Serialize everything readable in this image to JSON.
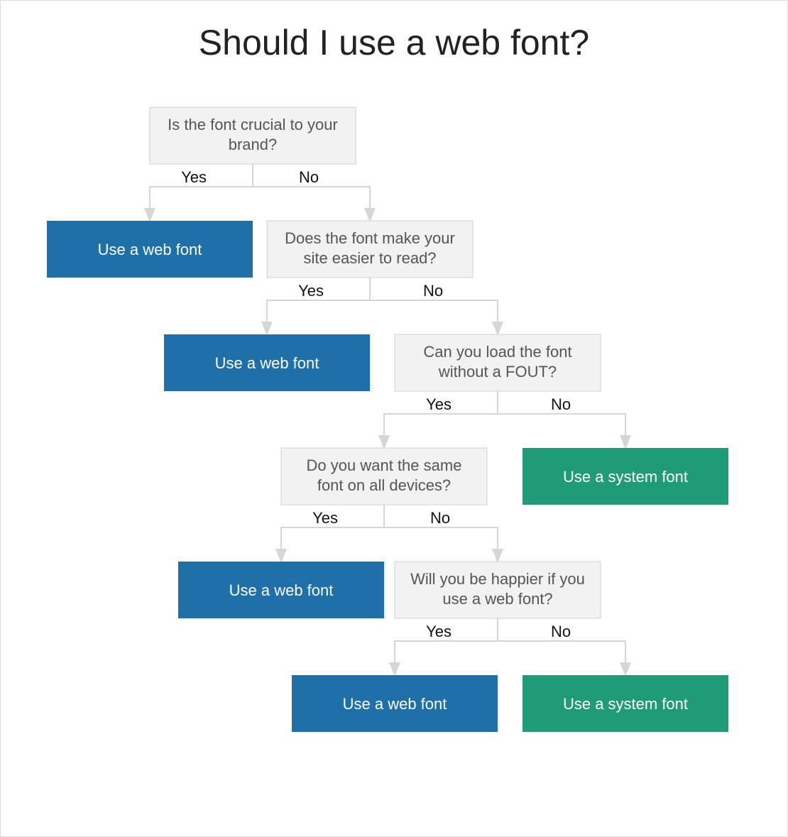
{
  "title": "Should I use a web font?",
  "labels": {
    "yes": "Yes",
    "no": "No"
  },
  "answers": {
    "web": "Use a web font",
    "system": "Use a system font"
  },
  "q1": {
    "line1": "Is the font crucial to your",
    "line2": "brand?"
  },
  "q2": {
    "line1": "Does the font make your",
    "line2": "site easier to read?"
  },
  "q3": {
    "line1": "Can you load the font",
    "line2": "without a FOUT?"
  },
  "q4": {
    "line1": "Do you want the same",
    "line2": "font on all devices?"
  },
  "q5": {
    "line1": "Will you be happier if you",
    "line2": "use a web font?"
  },
  "chart_data": {
    "type": "flowchart",
    "title": "Should I use a web font?",
    "nodes": [
      {
        "id": "q1",
        "kind": "question",
        "text": "Is the font crucial to your brand?"
      },
      {
        "id": "a1",
        "kind": "outcome",
        "text": "Use a web font",
        "color": "blue"
      },
      {
        "id": "q2",
        "kind": "question",
        "text": "Does the font make your site easier to read?"
      },
      {
        "id": "a2",
        "kind": "outcome",
        "text": "Use a web font",
        "color": "blue"
      },
      {
        "id": "q3",
        "kind": "question",
        "text": "Can you load the font without a FOUT?"
      },
      {
        "id": "q4",
        "kind": "question",
        "text": "Do you want the same font on all devices?"
      },
      {
        "id": "a3",
        "kind": "outcome",
        "text": "Use a system font",
        "color": "green"
      },
      {
        "id": "a4",
        "kind": "outcome",
        "text": "Use a web font",
        "color": "blue"
      },
      {
        "id": "q5",
        "kind": "question",
        "text": "Will you be happier if you use a web font?"
      },
      {
        "id": "a5",
        "kind": "outcome",
        "text": "Use a web font",
        "color": "blue"
      },
      {
        "id": "a6",
        "kind": "outcome",
        "text": "Use a system font",
        "color": "green"
      }
    ],
    "edges": [
      {
        "from": "q1",
        "to": "a1",
        "label": "Yes"
      },
      {
        "from": "q1",
        "to": "q2",
        "label": "No"
      },
      {
        "from": "q2",
        "to": "a2",
        "label": "Yes"
      },
      {
        "from": "q2",
        "to": "q3",
        "label": "No"
      },
      {
        "from": "q3",
        "to": "q4",
        "label": "Yes"
      },
      {
        "from": "q3",
        "to": "a3",
        "label": "No"
      },
      {
        "from": "q4",
        "to": "a4",
        "label": "Yes"
      },
      {
        "from": "q4",
        "to": "q5",
        "label": "No"
      },
      {
        "from": "q5",
        "to": "a5",
        "label": "Yes"
      },
      {
        "from": "q5",
        "to": "a6",
        "label": "No"
      }
    ]
  }
}
